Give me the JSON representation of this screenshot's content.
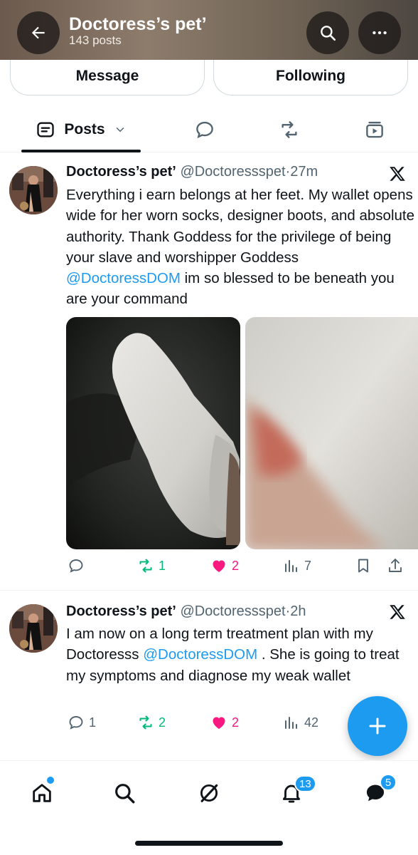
{
  "header": {
    "title": "Doctoress’s pet’",
    "subtitle": "143 posts",
    "back_icon": "arrow-left-icon",
    "search_icon": "search-icon",
    "more_icon": "more-horizontal-icon"
  },
  "profile_actions": {
    "message_label": "Message",
    "following_label": "Following"
  },
  "tabs": {
    "posts_label": "Posts",
    "items": [
      "posts",
      "replies",
      "reposts",
      "videos"
    ]
  },
  "posts": [
    {
      "author": "Doctoress’s pet’",
      "handle": "@Doctoressspet",
      "time": "27m",
      "text_1": "Everything i earn belongs at her feet. My wallet opens wide for her worn socks, designer boots, and absolute authority. Thank Goddess for the privilege of being your slave and worshipper Goddess ",
      "mention_1": "@DoctoressDOM",
      "text_2": " im so blessed to be beneath you are your command",
      "replies": "",
      "reposts": "1",
      "likes": "2",
      "views": "7"
    },
    {
      "author": "Doctoress’s pet’",
      "handle": "@Doctoressspet",
      "time": "2h",
      "text_1": "I am now on a long term treatment plan with my Doctoresss ",
      "mention_1": "@DoctoressDOM",
      "text_2": " . She is going to treat my symptoms and diagnose my weak wallet",
      "replies": "1",
      "reposts": "2",
      "likes": "2",
      "views": "42"
    }
  ],
  "nav": {
    "notifications_badge": "13",
    "messages_badge": "5"
  },
  "colors": {
    "accent": "#1d9bf0",
    "repost_green": "#00ba7c",
    "like_pink": "#f91880",
    "muted": "#536471"
  }
}
